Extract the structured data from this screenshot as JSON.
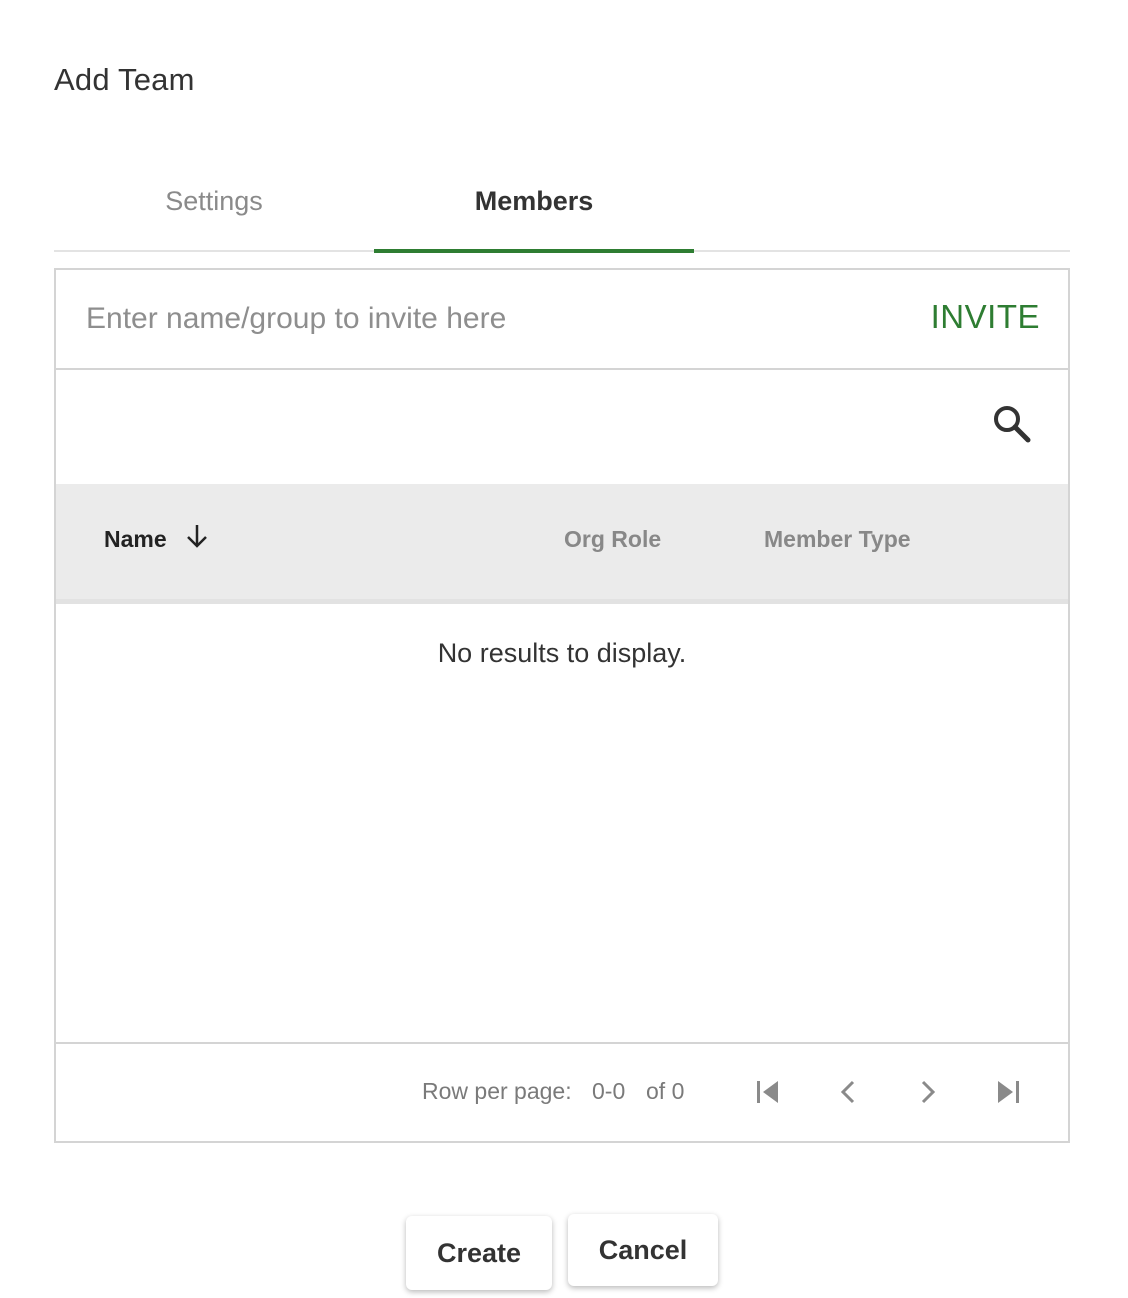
{
  "dialog": {
    "title": "Add Team"
  },
  "tabs": [
    {
      "label": "Settings",
      "active": false
    },
    {
      "label": "Members",
      "active": true
    }
  ],
  "invite": {
    "placeholder": "Enter name/group to invite here",
    "value": "",
    "button_label": "INVITE"
  },
  "search": {
    "icon": "search-icon"
  },
  "table": {
    "columns": [
      {
        "label": "Name",
        "sort": "descending"
      },
      {
        "label": "Org Role"
      },
      {
        "label": "Member Type"
      }
    ],
    "rows": [],
    "empty_message": "No results to display."
  },
  "pagination": {
    "rows_label": "Row per page:",
    "range": "0-0",
    "total_label": "of 0",
    "icons": [
      "first-page-icon",
      "previous-page-icon",
      "next-page-icon",
      "last-page-icon"
    ]
  },
  "actions": {
    "create_label": "Create",
    "cancel_label": "Cancel"
  },
  "colors": {
    "accent": "#2e7d32",
    "header_bg": "#ebebeb",
    "border": "#d4d4d4"
  }
}
